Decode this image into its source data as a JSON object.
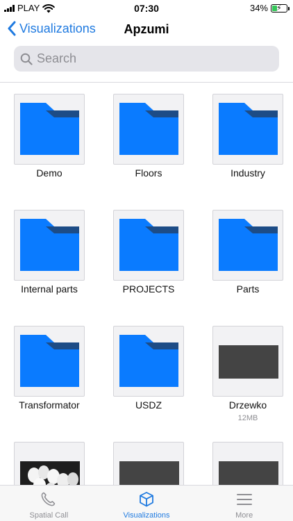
{
  "status_bar": {
    "carrier": "PLAY",
    "time": "07:30",
    "battery_percent": "34%",
    "battery_level": 0.34,
    "charging": true
  },
  "nav": {
    "back_label": "Visualizations",
    "title": "Apzumi"
  },
  "search": {
    "placeholder": "Search",
    "value": ""
  },
  "items": [
    {
      "name": "Demo",
      "kind": "folder",
      "icon": "folder-icon"
    },
    {
      "name": "Floors",
      "kind": "folder",
      "icon": "folder-icon"
    },
    {
      "name": "Industry",
      "kind": "folder",
      "icon": "folder-icon"
    },
    {
      "name": "Internal parts",
      "kind": "folder",
      "icon": "folder-icon"
    },
    {
      "name": "PROJECTS",
      "kind": "folder",
      "icon": "folder-icon"
    },
    {
      "name": "Parts",
      "kind": "folder",
      "icon": "folder-icon"
    },
    {
      "name": "Transformator",
      "kind": "folder",
      "icon": "folder-icon"
    },
    {
      "name": "USDZ",
      "kind": "folder",
      "icon": "folder-icon"
    },
    {
      "name": "Drzewko",
      "kind": "file",
      "size": "12MB",
      "icon": "file-preview"
    }
  ],
  "tab_bar": {
    "tabs": [
      {
        "label": "Spatial Call",
        "icon": "phone-icon",
        "active": false
      },
      {
        "label": "Visualizations",
        "icon": "cube-icon",
        "active": true
      },
      {
        "label": "More",
        "icon": "menu-icon",
        "active": false
      }
    ]
  },
  "colors": {
    "accent": "#1f7ae0",
    "folder_body": "#0a7bff",
    "folder_tab": "#1d4c86",
    "battery_fill": "#34c759"
  }
}
